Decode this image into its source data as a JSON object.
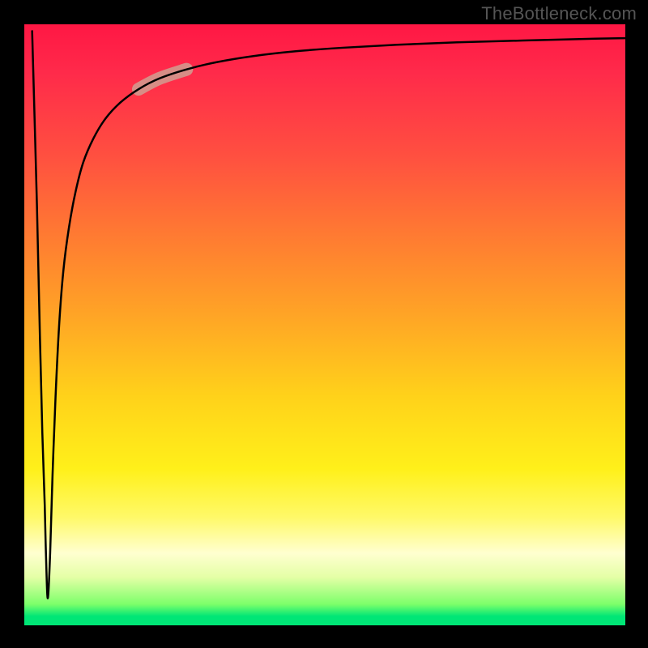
{
  "watermark": "TheBottleneck.com",
  "chart_data": {
    "type": "line",
    "title": "",
    "xlabel": "",
    "ylabel": "",
    "xlim": [
      0,
      100
    ],
    "ylim": [
      0,
      100
    ],
    "axes_visible": false,
    "background_gradient": {
      "orientation": "vertical",
      "stops": [
        {
          "pos": 0.0,
          "color": "#ff1744"
        },
        {
          "pos": 0.08,
          "color": "#ff2a4a"
        },
        {
          "pos": 0.22,
          "color": "#ff5040"
        },
        {
          "pos": 0.35,
          "color": "#ff7a32"
        },
        {
          "pos": 0.48,
          "color": "#ffa326"
        },
        {
          "pos": 0.62,
          "color": "#ffd21a"
        },
        {
          "pos": 0.74,
          "color": "#fff01a"
        },
        {
          "pos": 0.82,
          "color": "#fff968"
        },
        {
          "pos": 0.88,
          "color": "#ffffd0"
        },
        {
          "pos": 0.92,
          "color": "#e4ffa6"
        },
        {
          "pos": 0.965,
          "color": "#7cff6a"
        },
        {
          "pos": 0.985,
          "color": "#00e676"
        },
        {
          "pos": 1.0,
          "color": "#00e676"
        }
      ]
    },
    "series": [
      {
        "name": "bottleneck-curve",
        "color": "#000000",
        "stroke_width": 2.5,
        "x": [
          1.3,
          2.1,
          2.6,
          3.0,
          3.4,
          3.6,
          3.9,
          4.3,
          4.7,
          5.2,
          5.8,
          6.5,
          7.4,
          8.5,
          9.8,
          11.5,
          13.5,
          16.0,
          19.0,
          22.5,
          27.0,
          32.0,
          38.0,
          45.0,
          53.0,
          62.0,
          72.0,
          83.0,
          95.0,
          100.0
        ],
        "values": [
          99.0,
          70.0,
          48.0,
          32.0,
          20.0,
          12.0,
          4.5,
          12.0,
          25.0,
          38.0,
          50.0,
          59.0,
          66.0,
          72.0,
          77.0,
          81.0,
          84.3,
          87.0,
          89.2,
          91.0,
          92.5,
          93.7,
          94.7,
          95.5,
          96.1,
          96.6,
          97.0,
          97.3,
          97.6,
          97.7
        ]
      }
    ],
    "highlight": {
      "color": "#d29b8e",
      "opacity": 0.88,
      "stroke_width": 16,
      "x_range": [
        19.0,
        27.0
      ]
    }
  }
}
